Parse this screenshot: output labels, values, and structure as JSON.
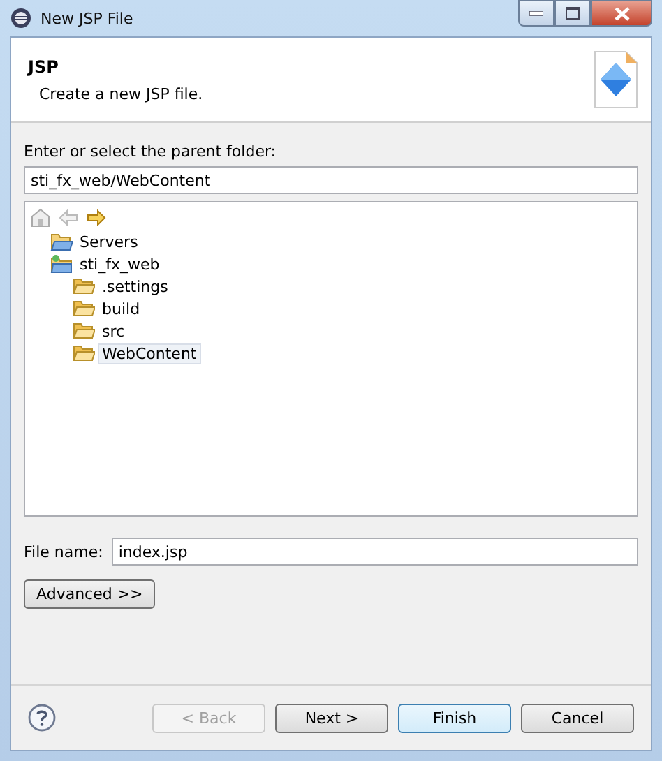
{
  "window": {
    "title": "New JSP File"
  },
  "header": {
    "title": "JSP",
    "description": "Create a new JSP file."
  },
  "parent_folder": {
    "label": "Enter or select the parent folder:",
    "value": "sti_fx_web/WebContent"
  },
  "tree_toolbar": [
    {
      "kind": "home",
      "disabled": true
    },
    {
      "kind": "back",
      "disabled": true
    },
    {
      "kind": "forward",
      "disabled": false
    }
  ],
  "tree": [
    {
      "label": "Servers",
      "kind": "folder-open",
      "selected": false
    },
    {
      "label": "sti_fx_web",
      "kind": "project",
      "selected": false,
      "children": [
        {
          "label": ".settings",
          "kind": "folder",
          "selected": false
        },
        {
          "label": "build",
          "kind": "folder",
          "selected": false
        },
        {
          "label": "src",
          "kind": "folder",
          "selected": false
        },
        {
          "label": "WebContent",
          "kind": "folder",
          "selected": true
        }
      ]
    }
  ],
  "file_name": {
    "label": "File name:",
    "value": "index.jsp"
  },
  "advanced_button": "Advanced >>",
  "buttons": [
    {
      "label": "< Back",
      "disabled": true,
      "default": false
    },
    {
      "label": "Next >",
      "disabled": false,
      "default": false
    },
    {
      "label": "Finish",
      "disabled": false,
      "default": true
    },
    {
      "label": "Cancel",
      "disabled": false,
      "default": false
    }
  ]
}
